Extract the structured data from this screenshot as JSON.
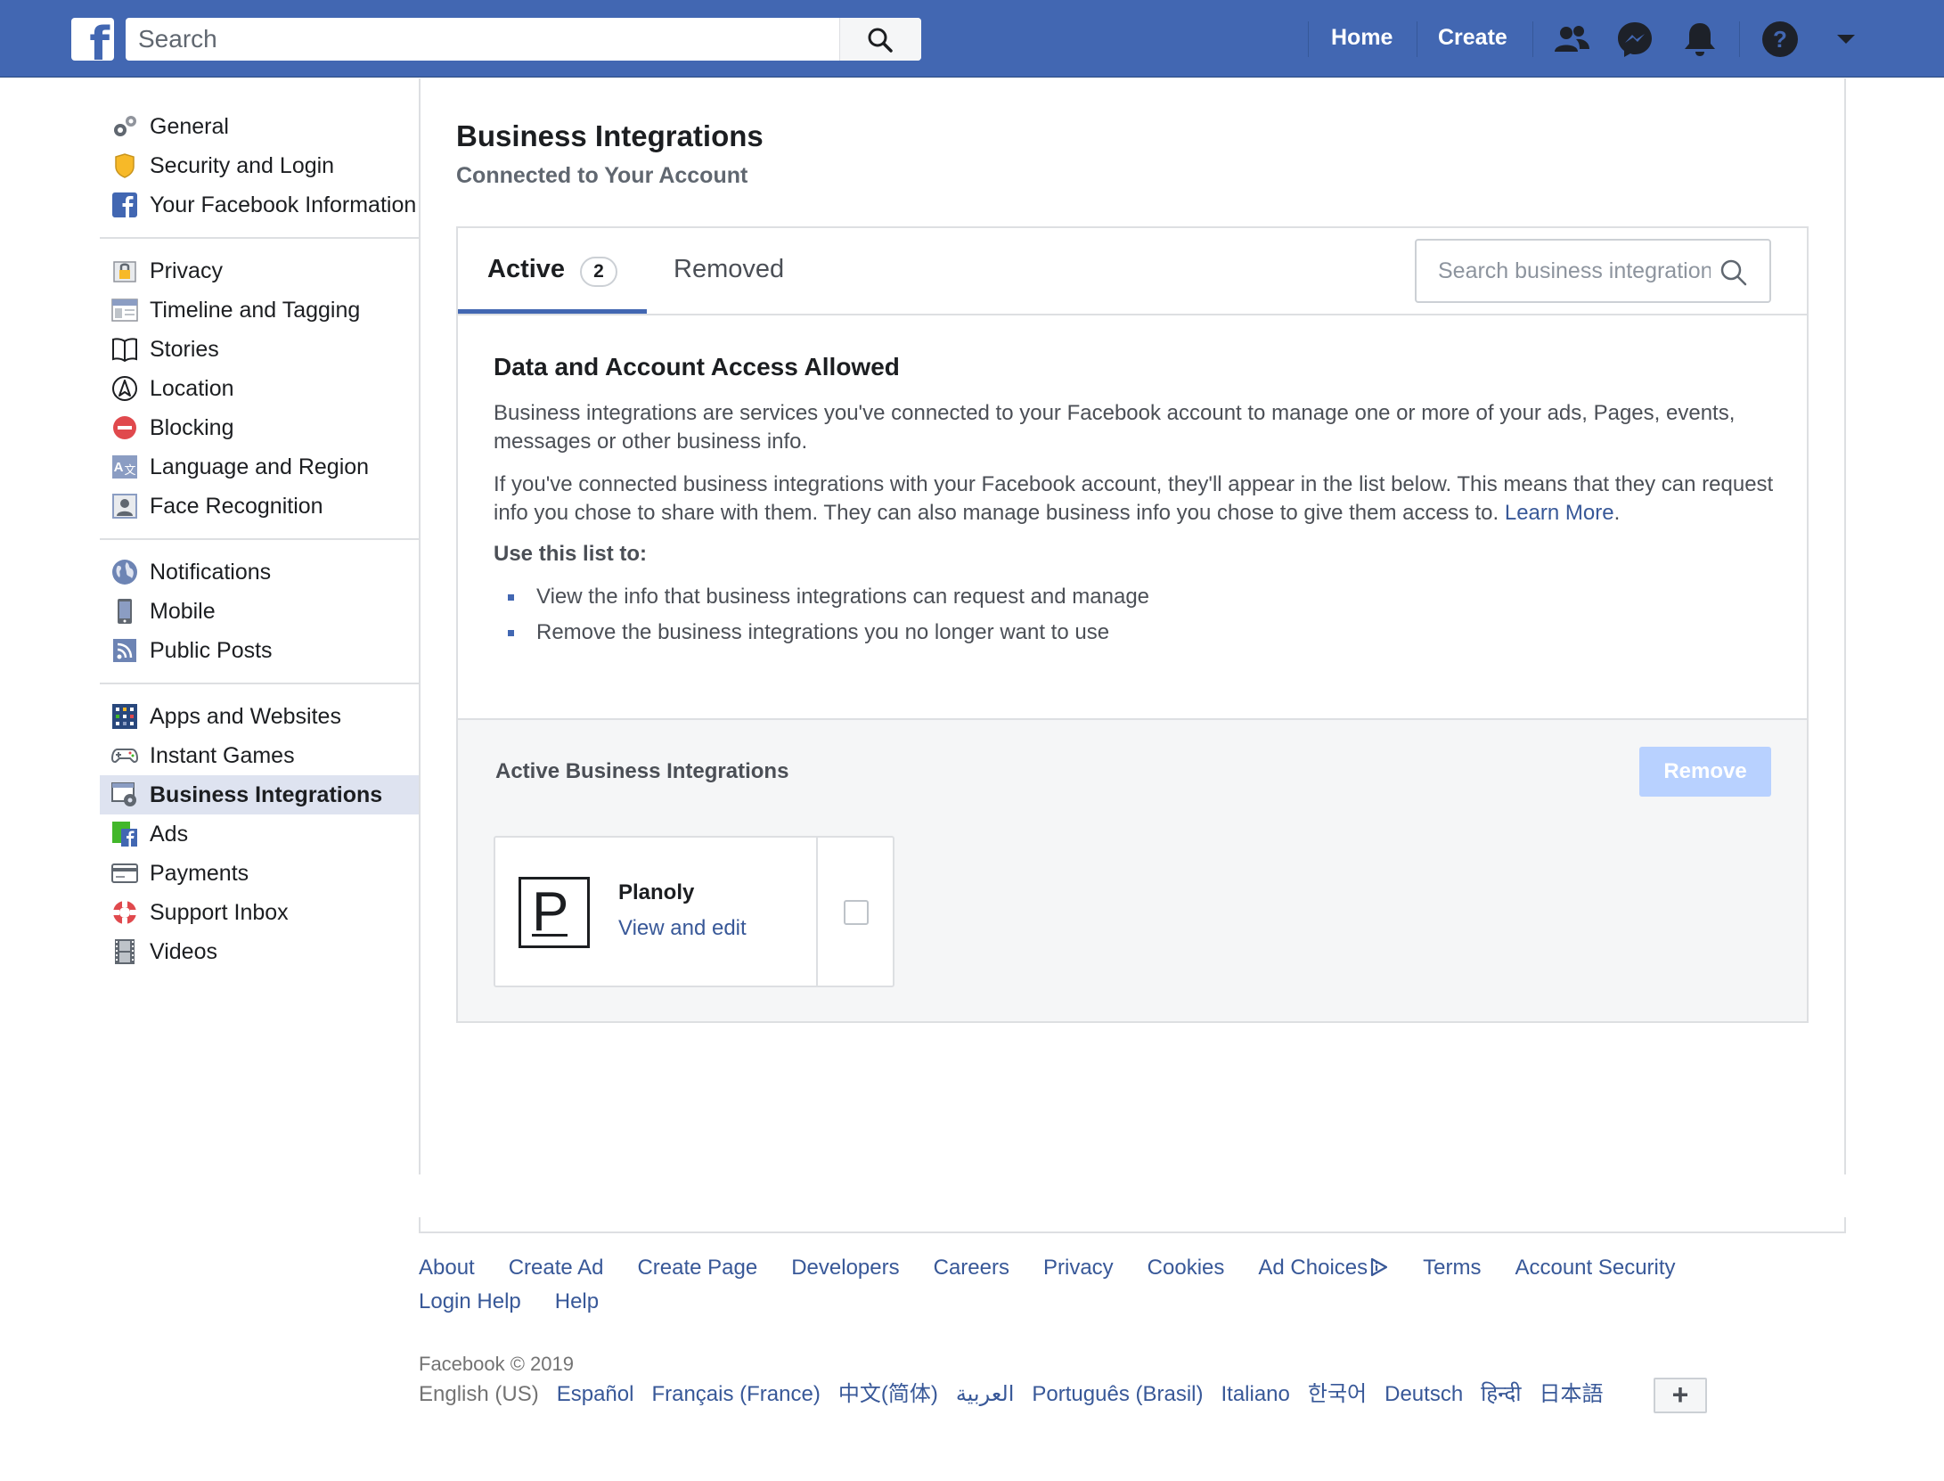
{
  "topbar": {
    "search_placeholder": "Search",
    "home_label": "Home",
    "create_label": "Create",
    "brand_color": "#4267b2",
    "icons": [
      "friends-icon",
      "messenger-icon",
      "notifications-icon",
      "help-icon",
      "account-menu-icon"
    ]
  },
  "sidebar": {
    "groups": [
      [
        {
          "label": "General",
          "icon": "gears-icon"
        },
        {
          "label": "Security and Login",
          "icon": "shield-icon"
        },
        {
          "label": "Your Facebook Information",
          "icon": "facebook-icon"
        }
      ],
      [
        {
          "label": "Privacy",
          "icon": "lock-icon"
        },
        {
          "label": "Timeline and Tagging",
          "icon": "timeline-icon"
        },
        {
          "label": "Stories",
          "icon": "book-icon"
        },
        {
          "label": "Location",
          "icon": "location-icon"
        },
        {
          "label": "Blocking",
          "icon": "block-icon"
        },
        {
          "label": "Language and Region",
          "icon": "language-icon"
        },
        {
          "label": "Face Recognition",
          "icon": "face-recognition-icon"
        }
      ],
      [
        {
          "label": "Notifications",
          "icon": "globe-icon"
        },
        {
          "label": "Mobile",
          "icon": "phone-icon"
        },
        {
          "label": "Public Posts",
          "icon": "rss-icon"
        }
      ],
      [
        {
          "label": "Apps and Websites",
          "icon": "apps-icon"
        },
        {
          "label": "Instant Games",
          "icon": "gamepad-icon"
        },
        {
          "label": "Business Integrations",
          "icon": "business-integrations-icon",
          "selected": true
        },
        {
          "label": "Ads",
          "icon": "ads-icon"
        },
        {
          "label": "Payments",
          "icon": "credit-card-icon"
        },
        {
          "label": "Support Inbox",
          "icon": "lifebuoy-icon"
        },
        {
          "label": "Videos",
          "icon": "film-icon"
        }
      ]
    ]
  },
  "main": {
    "title": "Business Integrations",
    "subtitle": "Connected to Your Account",
    "tabs": {
      "active_label": "Active",
      "active_count": "2",
      "removed_label": "Removed"
    },
    "search_placeholder": "Search business integrations",
    "info": {
      "heading": "Data and Account Access Allowed",
      "para1": "Business integrations are services you've connected to your Facebook account to manage one or more of your ads, Pages, events, messages or other business info.",
      "para2": "If you've connected business integrations with your Facebook account, they'll appear in the list below. This means that they can request info you chose to share with them. They can also manage business info you chose to give them access to.",
      "learn_more": "Learn More",
      "period": ".",
      "use_list_title": "Use this list to:",
      "bullets": [
        "View the info that business integrations can request and manage",
        "Remove the business integrations you no longer want to use"
      ]
    },
    "active_section": {
      "title": "Active Business Integrations",
      "remove_label": "Remove",
      "integrations": [
        {
          "logo_letter": "P",
          "name": "Planoly",
          "link": "View and edit",
          "checked": false
        }
      ]
    }
  },
  "footer": {
    "links": [
      "About",
      "Create Ad",
      "Create Page",
      "Developers",
      "Careers",
      "Privacy",
      "Cookies",
      "Ad Choices",
      "Terms",
      "Account Security",
      "Login Help",
      "Help"
    ],
    "copyright": "Facebook © 2019",
    "current_language": "English (US)",
    "languages": [
      "Español",
      "Français (France)",
      "中文(简体)",
      "العربية",
      "Português (Brasil)",
      "Italiano",
      "한국어",
      "Deutsch",
      "हिन्दी",
      "日本語"
    ],
    "more_languages": "+"
  }
}
